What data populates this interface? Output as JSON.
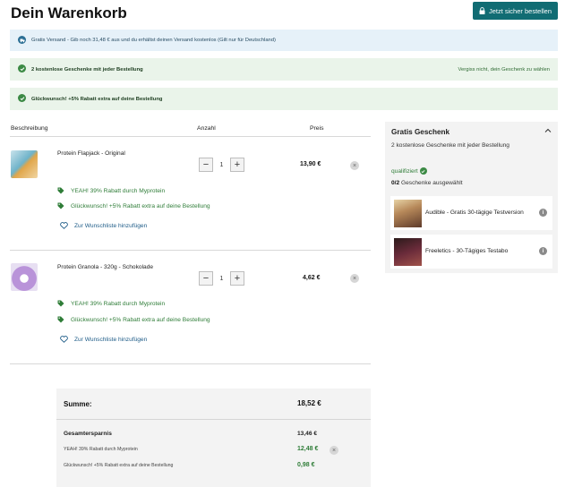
{
  "header": {
    "title": "Dein Warenkorb",
    "checkout_label": "Jetzt sicher bestellen"
  },
  "banners": {
    "shipping": "Gratis Versand - Gib noch 31,48 € aus und du erhältst deinen Versand kostenlos (Gilt nur für Deutschland)",
    "gifts": "2 kostenlose Geschenke mit jeder Bestellung",
    "gifts_reminder": "Vergiss nicht, dein Geschenk zu wählen",
    "rebate": "Glückwunsch! +5% Rabatt extra auf deine Bestellung"
  },
  "table": {
    "col_description": "Beschreibung",
    "col_quantity": "Anzahl",
    "col_price": "Preis"
  },
  "items": [
    {
      "name": "Protein Flapjack - Original",
      "quantity": "1",
      "price": "13,90 €",
      "promo_1": "YEAH! 39% Rabatt durch Myprotein",
      "promo_2": "Glückwunsch! +5% Rabatt extra auf deine Bestellung",
      "wishlist": "Zur Wunschliste hinzufügen"
    },
    {
      "name": "Protein Granola - 320g - Schokolade",
      "quantity": "1",
      "price": "4,62 €",
      "promo_1": "YEAH! 39% Rabatt durch Myprotein",
      "promo_2": "Glückwunsch! +5% Rabatt extra auf deine Bestellung",
      "wishlist": "Zur Wunschliste hinzufügen"
    }
  ],
  "controls": {
    "minus": "−",
    "plus": "+",
    "remove": "×"
  },
  "sidebar": {
    "title": "Gratis Geschenk",
    "subtitle": "2 kostenlose Geschenke mit jeder Bestellung",
    "qualified": "qualifiziert",
    "selected_count": "0/2",
    "selected_suffix": " Geschenke ausgewählt",
    "gifts": [
      {
        "name": "Audible - Gratis 30-tägige Testversion",
        "info": "i"
      },
      {
        "name": "Freeletics - 30-Tägiges Testabo",
        "info": "i"
      }
    ]
  },
  "summary": {
    "total_label": "Summe:",
    "total_value": "18,52 €",
    "savings_label": "Gesamtersparnis",
    "savings_value": "13,46 €",
    "savings_rows": [
      {
        "label": "YEAH! 39% Rabatt durch Myprotein",
        "value": "12,48 €"
      },
      {
        "label": "Glückwunsch! +5% Rabatt extra auf deine Bestellung",
        "value": "0,98 €"
      }
    ]
  },
  "colors": {
    "primary": "#116c73",
    "success": "#3c8a45",
    "info": "#2c6f95"
  }
}
